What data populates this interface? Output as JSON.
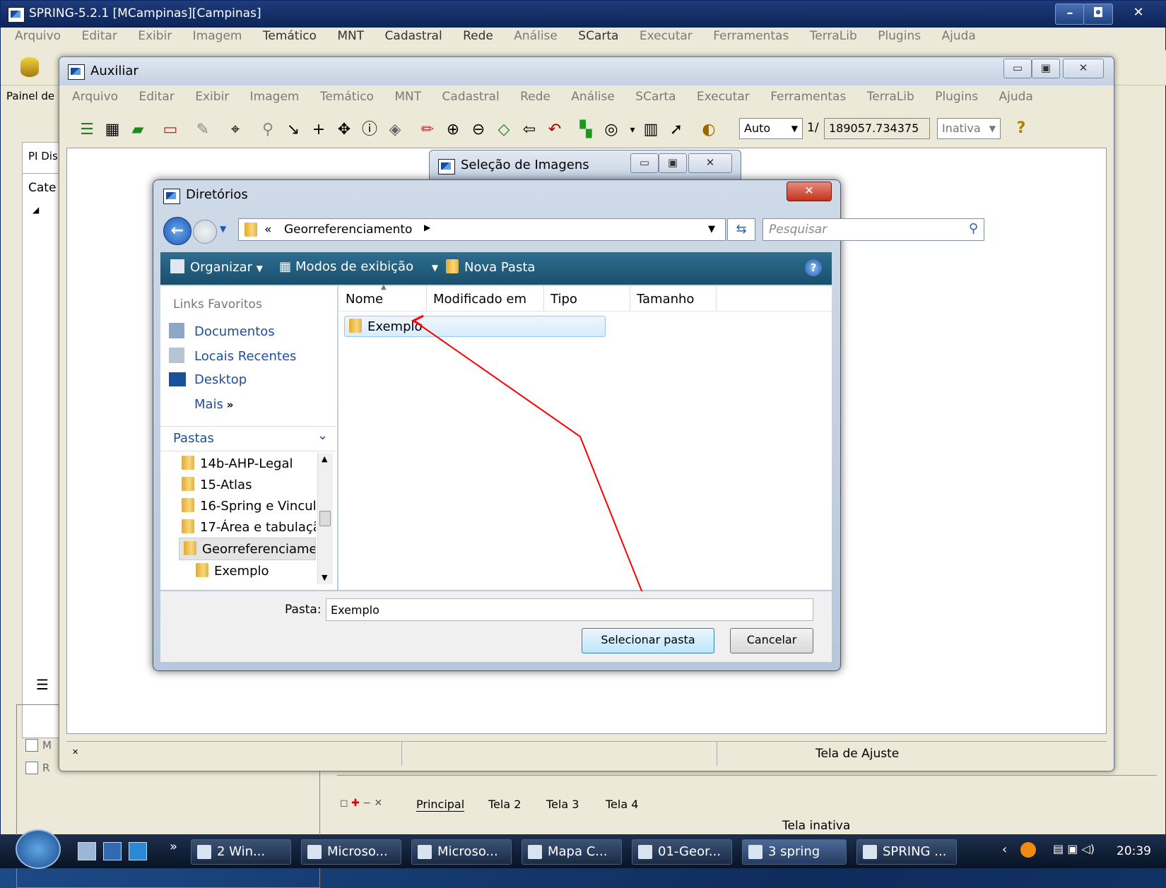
{
  "main_window": {
    "title": "SPRING-5.2.1 [MCampinas][Campinas]",
    "menu": [
      "Arquivo",
      "Editar",
      "Exibir",
      "Imagem",
      "Temático",
      "MNT",
      "Cadastral",
      "Rede",
      "Análise",
      "SCarta",
      "Executar",
      "Ferramentas",
      "TerraLib",
      "Plugins",
      "Ajuda"
    ],
    "painel_label": "Painel de",
    "pi_label": "PI Dis",
    "cat_label": "Cate",
    "check_m": "M",
    "check_r": "R",
    "tabs": [
      "Principal",
      "Tela 2",
      "Tela 3",
      "Tela 4"
    ],
    "status": "Tela inativa"
  },
  "aux_window": {
    "title": "Auxiliar",
    "menu": [
      "Arquivo",
      "Editar",
      "Exibir",
      "Imagem",
      "Temático",
      "MNT",
      "Cadastral",
      "Rede",
      "Análise",
      "SCarta",
      "Executar",
      "Ferramentas",
      "TerraLib",
      "Plugins",
      "Ajuda"
    ],
    "auto_combo": "Auto",
    "scale_prefix": "1/",
    "scale_value": "189057.734375",
    "inativa_combo": "Inativa",
    "status_right": "Tela de Ajuste"
  },
  "selecao_window": {
    "title": "Seleção de Imagens"
  },
  "dialog": {
    "title": "Diretórios",
    "address_prefix": "«",
    "address_path": "Georreferenciamento",
    "search_placeholder": "Pesquisar",
    "commands": {
      "organize": "Organizar",
      "views": "Modos de exibição",
      "new_folder": "Nova Pasta"
    },
    "favorites_header": "Links Favoritos",
    "favorites": [
      "Documentos",
      "Locais Recentes",
      "Desktop",
      "Mais"
    ],
    "folders_header": "Pastas",
    "folders": [
      "14b-AHP-Legal",
      "15-Atlas",
      "16-Spring e Vincul",
      "17-Área e tabulaçã",
      "Georreferenciamei",
      "Exemplo"
    ],
    "columns": [
      "Nome",
      "Modificado em",
      "Tipo",
      "Tamanho"
    ],
    "files": [
      {
        "name": "Exemplo"
      }
    ],
    "pasta_label": "Pasta:",
    "pasta_value": "Exemplo",
    "select_button": "Selecionar pasta",
    "cancel_button": "Cancelar"
  },
  "taskbar": {
    "tasks": [
      "2 Win...",
      "Microso...",
      "Microso...",
      "Mapa C...",
      "01-Geor...",
      "3 spring",
      "SPRING ..."
    ],
    "clock": "20:39"
  },
  "colors": {
    "annotation_arrow": "#ff0000",
    "command_bar": "#1f5a7a",
    "link": "#1f4e9a"
  }
}
